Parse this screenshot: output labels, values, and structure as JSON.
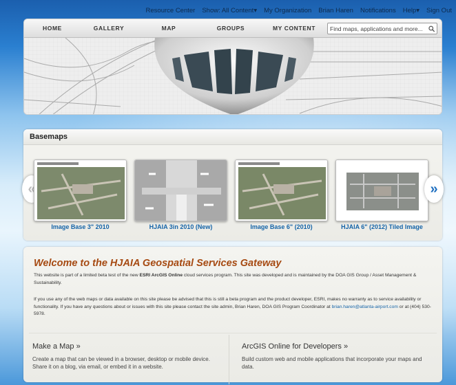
{
  "top_links": [
    "Resource Center",
    "Show: All Content▾",
    "My Organization",
    "Brian Haren",
    "Notifications",
    "Help▾",
    "Sign Out"
  ],
  "nav": [
    "HOME",
    "GALLERY",
    "MAP",
    "GROUPS",
    "MY CONTENT"
  ],
  "search": {
    "placeholder": "Find maps, applications and more..."
  },
  "basemaps": {
    "heading": "Basemaps",
    "items": [
      {
        "title": "Image Base 3\" 2010"
      },
      {
        "title": "HJAIA 3in 2010 (New)"
      },
      {
        "title": "Image Base 6\" (2010)"
      },
      {
        "title": "HJAIA 6\" (2012) Tiled Image"
      }
    ],
    "prev_glyph": "«",
    "next_glyph": "»"
  },
  "welcome": {
    "title": "Welcome to the HJAIA Geospatial Services Gateway",
    "p1_a": "This website is part of a limited beta test of the new ",
    "p1_b": "ESRI ArcGIS Online",
    "p1_c": " cloud services program.  This site was developed and is maintained by the DOA GIS Group / Asset Management & Sustainability.",
    "p2_a": "If you use any of the web maps or data available on this site please be advised that this is still a beta program and the product developer, ESRI,  makes no warranty as to service availability or functionality.  If you have any questions about or issues with this site please contact the site admin, Brian Haren, DOA GIS Program Coordinator at ",
    "email": "brian.haren@atlanta-airport.com",
    "p2_c": " or at (404) 530-5978.",
    "left_heading": "Make a Map »",
    "left_text": "Create a map that can be viewed in a browser, desktop or mobile device. Share it on a blog, via email, or embed it in a website.",
    "right_heading": "ArcGIS Online for Developers »",
    "right_text": "Build custom web and mobile applications that incorporate your maps and data."
  },
  "colors": {
    "title": "#a64a12",
    "link": "#1564a8",
    "page_bg": "#1a66b8"
  }
}
